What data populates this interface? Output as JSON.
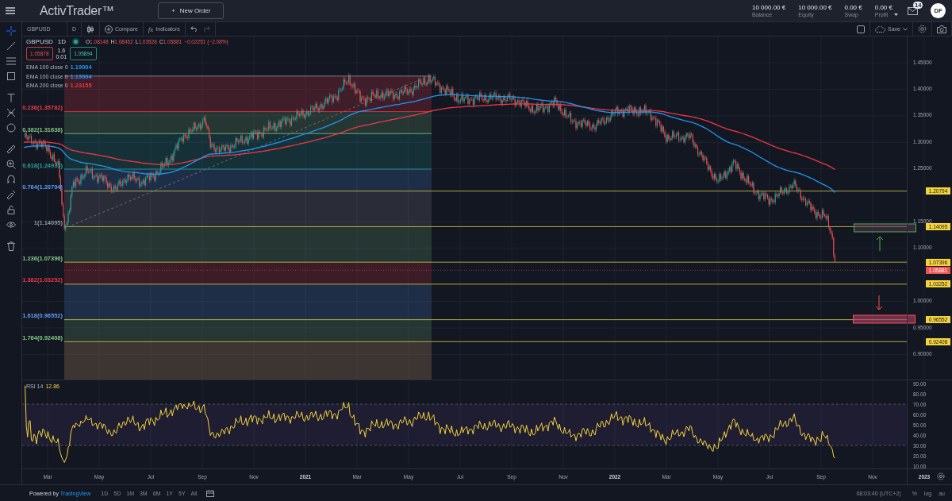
{
  "header": {
    "logo": "ActivTrader™",
    "new_order": {
      "icon": "+",
      "label": "New Order"
    },
    "stats": [
      {
        "value": "10 000.00 €",
        "label": "Balance"
      },
      {
        "value": "10 000.00 €",
        "label": "Equity"
      },
      {
        "value": "0.00 €",
        "label": "Swap"
      },
      {
        "value": "0.00 €",
        "label": "Profit"
      }
    ],
    "messages_badge": "14",
    "avatar": "DF"
  },
  "toolbar": {
    "symbol": "GBPUSD",
    "interval": "D",
    "compare": "Compare",
    "indicators_icon": "fx",
    "indicators": "Indicators",
    "save": "Save"
  },
  "legend": {
    "symbol": "GBPUSD",
    "interval": "1D",
    "ohlc": [
      {
        "key": "O",
        "value": "1.08148"
      },
      {
        "key": "H",
        "value": "1.08452"
      },
      {
        "key": "L",
        "value": "1.03528"
      },
      {
        "key": "C",
        "value": "1.05881"
      }
    ],
    "change": "−0.02251 (−2.08%)",
    "sell": "1.05878",
    "spread": "1.6",
    "spread_step": "0.01",
    "buy": "1.05894"
  },
  "indicators": [
    {
      "label": "EMA 100 close 0",
      "value": "1.19004",
      "color": "#2196f3"
    },
    {
      "label": "EMA 100 close 0",
      "value": "1.19004",
      "color": "#2196f3"
    },
    {
      "label": "EMA 200 close 0",
      "value": "1.23155",
      "color": "#f23645"
    }
  ],
  "fib_levels": [
    {
      "label": "0.236(1.35782)",
      "color": "#f23645"
    },
    {
      "label": "0.382(1.31638)",
      "color": "#81c784"
    },
    {
      "label": "0.618(1.24933)",
      "color": "#26a69a"
    },
    {
      "label": "0.764(1.20794)",
      "color": "#5b9cf6",
      "axis_tag": "1.20794"
    },
    {
      "label": "1(1.14095)",
      "color": "#9598a1",
      "axis_tag": "1.14095"
    },
    {
      "label": "1.236(1.07396)",
      "color": "#81c784",
      "axis_tag": "1.07396"
    },
    {
      "label": "1.382(1.03252)",
      "color": "#f23645",
      "axis_tag": "1.03252"
    },
    {
      "label": "1.618(0.96552)",
      "color": "#5b9cf6",
      "axis_tag": "0.96552"
    },
    {
      "label": "1.764(0.92408)",
      "color": "#81c784",
      "axis_tag": "0.92408"
    }
  ],
  "last_price": "1.05881",
  "price_axis": [
    "1.45000",
    "1.40000",
    "1.35000",
    "1.30000",
    "1.25000",
    "1.15000",
    "1.10000",
    "1.00000",
    "0.95000",
    "0.90000"
  ],
  "rsi": {
    "label": "RSI 14",
    "value": "12.86",
    "ticks": [
      "90.00",
      "80.00",
      "70.00",
      "60.00",
      "50.00",
      "40.00",
      "30.00",
      "20.00",
      "10.00"
    ]
  },
  "time_axis": [
    "Mar",
    "May",
    "Jul",
    "Sep",
    "Nov",
    "2021",
    "Mar",
    "May",
    "Jul",
    "Sep",
    "Nov",
    "2022",
    "Mar",
    "May",
    "Jul",
    "Sep",
    "Nov",
    "2023"
  ],
  "bottom_bar": {
    "powered_by": "Powered by",
    "brand": "TradingView",
    "ranges": [
      "1D",
      "5D",
      "1M",
      "3M",
      "6M",
      "1Y",
      "5Y",
      "All"
    ],
    "clock": "08:03:40 (UTC+2)",
    "options": [
      "%",
      "log",
      "au"
    ]
  }
}
